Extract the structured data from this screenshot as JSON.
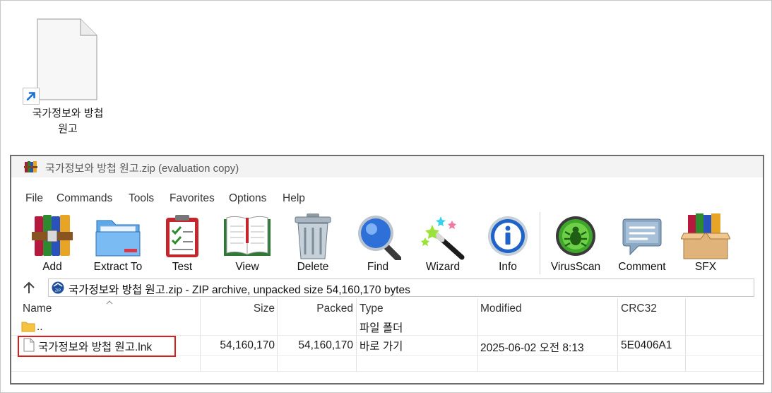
{
  "desktop": {
    "shortcut_label_line1": "국가정보와 방첩",
    "shortcut_label_line2": "원고"
  },
  "window": {
    "title": "국가정보와 방첩 원고.zip (evaluation copy)",
    "menu": [
      "File",
      "Commands",
      "Tools",
      "Favorites",
      "Options",
      "Help"
    ],
    "toolbar": {
      "add": "Add",
      "extract": "Extract To",
      "test": "Test",
      "view": "View",
      "delete": "Delete",
      "find": "Find",
      "wizard": "Wizard",
      "info": "Info",
      "virusscan": "VirusScan",
      "comment": "Comment",
      "sfx": "SFX"
    },
    "address": "국가정보와 방첩 원고.zip - ZIP archive, unpacked size 54,160,170 bytes",
    "columns": {
      "name": "Name",
      "size": "Size",
      "packed": "Packed",
      "type": "Type",
      "modified": "Modified",
      "crc": "CRC32"
    },
    "rows": [
      {
        "name": "..",
        "size": "",
        "packed": "",
        "type": "파일 폴더",
        "modified": "",
        "crc": ""
      },
      {
        "name": "국가정보와 방첩 원고.lnk",
        "size": "54,160,170",
        "packed": "54,160,170",
        "type": "바로 가기",
        "modified": "2025-06-02 오전 8:13",
        "crc": "5E0406A1"
      }
    ]
  },
  "colors": {
    "selection_outline": "#d91e1e",
    "shortcut_arrow": "#1a6fd6"
  }
}
